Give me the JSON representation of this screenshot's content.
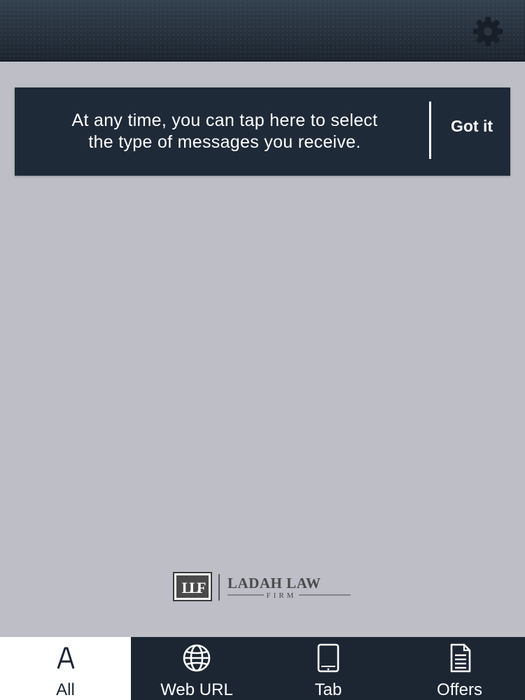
{
  "header": {
    "settings_icon": "gear-icon"
  },
  "tooltip": {
    "line1": "At any time, you can tap here to select",
    "line2": "the type of messages you receive.",
    "action_label": "Got it"
  },
  "brand": {
    "name": "LADAH LAW",
    "subtitle": "FIRM",
    "monogram": "LLF"
  },
  "nav": {
    "tabs": [
      {
        "label": "All",
        "icon": "letter-a-icon",
        "active": true
      },
      {
        "label": "Web URL",
        "icon": "globe-icon",
        "active": false
      },
      {
        "label": "Tab",
        "icon": "tablet-icon",
        "active": false
      },
      {
        "label": "Offers",
        "icon": "document-icon",
        "active": false
      }
    ]
  },
  "colors": {
    "top_bar": "#2a3340",
    "background": "#bdbec6",
    "tooltip": "#1f2a38",
    "bottom_nav": "#1c2633",
    "active_tab": "#ffffff"
  }
}
